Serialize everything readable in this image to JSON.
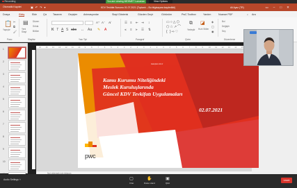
{
  "meeting": {
    "recording_label": "Recording",
    "viewing_label": "You are viewing MEHMET Lavuman",
    "view_options_label": "View Options"
  },
  "titlebar": {
    "quick_access_label": "Otomatik Kaydet",
    "document_title": "KDV Tevkifat Sunumu 01.07.2021 (Toplantı – Bu bilgisayara kaydedildi)",
    "user_name": "Ali Ayaz (TR)",
    "user_initials": "AA"
  },
  "ribbon_tabs": [
    "Dosya",
    "Giriş",
    "Ekle",
    "Çiz",
    "Tasarım",
    "Geçişler",
    "Animasyonlar",
    "Slayt Gösterisi",
    "Gözden Geçir",
    "Görünüm",
    "PwC Toolbox",
    "Yardım",
    "Nuance PDF",
    "Ara"
  ],
  "ribbon_active_tab": "Giriş",
  "ribbon_groups": [
    "Pano",
    "Slaytlar",
    "Yazı Tipi",
    "Paragraf",
    "Çizim",
    "Düzenleme"
  ],
  "ribbon_buttons": {
    "paste": "Yapıştır",
    "new_slide": "Yeni Slayt",
    "layout": "Düzen",
    "reset": "Sıfırla",
    "section": "Bölüm",
    "arrange": "Yerleştir",
    "quick_styles": "Hızlı Stiller",
    "find": "Bul",
    "replace": "Değiştir",
    "select": "Seç"
  },
  "slide_count": 11,
  "selected_slide": 1,
  "ruler_numbers": [
    "16",
    "15",
    "14",
    "13",
    "12",
    "11",
    "10",
    "9",
    "8",
    "7",
    "6",
    "5",
    "4",
    "3",
    "2",
    "1",
    "0",
    "1",
    "2",
    "3",
    "4",
    "5",
    "6",
    "7",
    "8",
    "9",
    "10",
    "11",
    "12",
    "13",
    "14",
    "15",
    "16"
  ],
  "slide": {
    "title_lines": [
      "Kamu Kurumu Niteliğindeki",
      "Meslek Kuruluşlarında",
      "Güncel KDV Tevkifatı Uygulamaları"
    ],
    "date": "02.07.2021",
    "logo_text": "pwc",
    "tiny_text": "www.pwc.com.tr",
    "colors": {
      "orange": "#eb8c00",
      "red": "#e0301e",
      "dark_red": "#a32020",
      "rose": "#db536a"
    }
  },
  "notes_placeholder": "Not eklemek için tıklayın",
  "status": {
    "audio_label": "Audio Settings",
    "chat_label": "Chat",
    "raise_hand_label": "Raise Hand",
    "qa_label": "Q&A",
    "leave_label": "Leave"
  }
}
